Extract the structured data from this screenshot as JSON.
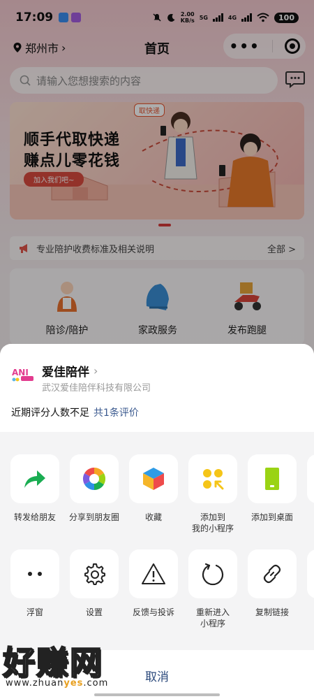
{
  "status_bar": {
    "time": "17:09",
    "speed_value": "2.00",
    "speed_unit": "KB/s",
    "net1": "5G",
    "net2": "4G",
    "battery": "100"
  },
  "nav": {
    "city": "郑州市",
    "title": "首页"
  },
  "search": {
    "placeholder": "请输入您想搜索的内容"
  },
  "banner": {
    "line1": "顺手代取快递",
    "line2": "赚点儿零花钱",
    "join": "加入我们吧~",
    "tag": "取快递"
  },
  "notice": {
    "text": "专业陪护收费标准及相关说明",
    "more": "全部 >"
  },
  "services": [
    {
      "label": "陪诊/陪护",
      "icon": "nurse-icon"
    },
    {
      "label": "家政服务",
      "icon": "cleaning-glove-icon"
    },
    {
      "label": "发布跑腿",
      "icon": "delivery-scooter-icon"
    }
  ],
  "sheet": {
    "mp_name": "爱佳陪伴",
    "mp_company": "武汉爱佳陪伴科技有限公司",
    "rating_text": "近期评分人数不足",
    "rating_link": "共1条评价",
    "row1": [
      {
        "label": "转发给朋友",
        "icon": "forward-icon",
        "accent": "#1aad52"
      },
      {
        "label": "分享到朋友圈",
        "icon": "moments-icon",
        "accent": "#f5a623"
      },
      {
        "label": "收藏",
        "icon": "favorite-cube-icon",
        "accent": "#f0a32c"
      },
      {
        "label": "添加到\n我的小程序",
        "icon": "add-miniprogram-icon",
        "accent": "#f5c518"
      },
      {
        "label": "添加到桌面",
        "icon": "add-desktop-icon",
        "accent": "#9ad314"
      }
    ],
    "row2": [
      {
        "label": "浮窗",
        "icon": "float-window-icon"
      },
      {
        "label": "设置",
        "icon": "gear-icon"
      },
      {
        "label": "反馈与投诉",
        "icon": "warning-icon"
      },
      {
        "label": "重新进入\n小程序",
        "icon": "reload-icon"
      },
      {
        "label": "复制链接",
        "icon": "link-icon"
      }
    ],
    "cancel": "取消"
  },
  "watermark": {
    "text": "好赚网",
    "url_prefix": "www.zhuan",
    "url_highlight": "yes",
    "url_suffix": ".com"
  }
}
